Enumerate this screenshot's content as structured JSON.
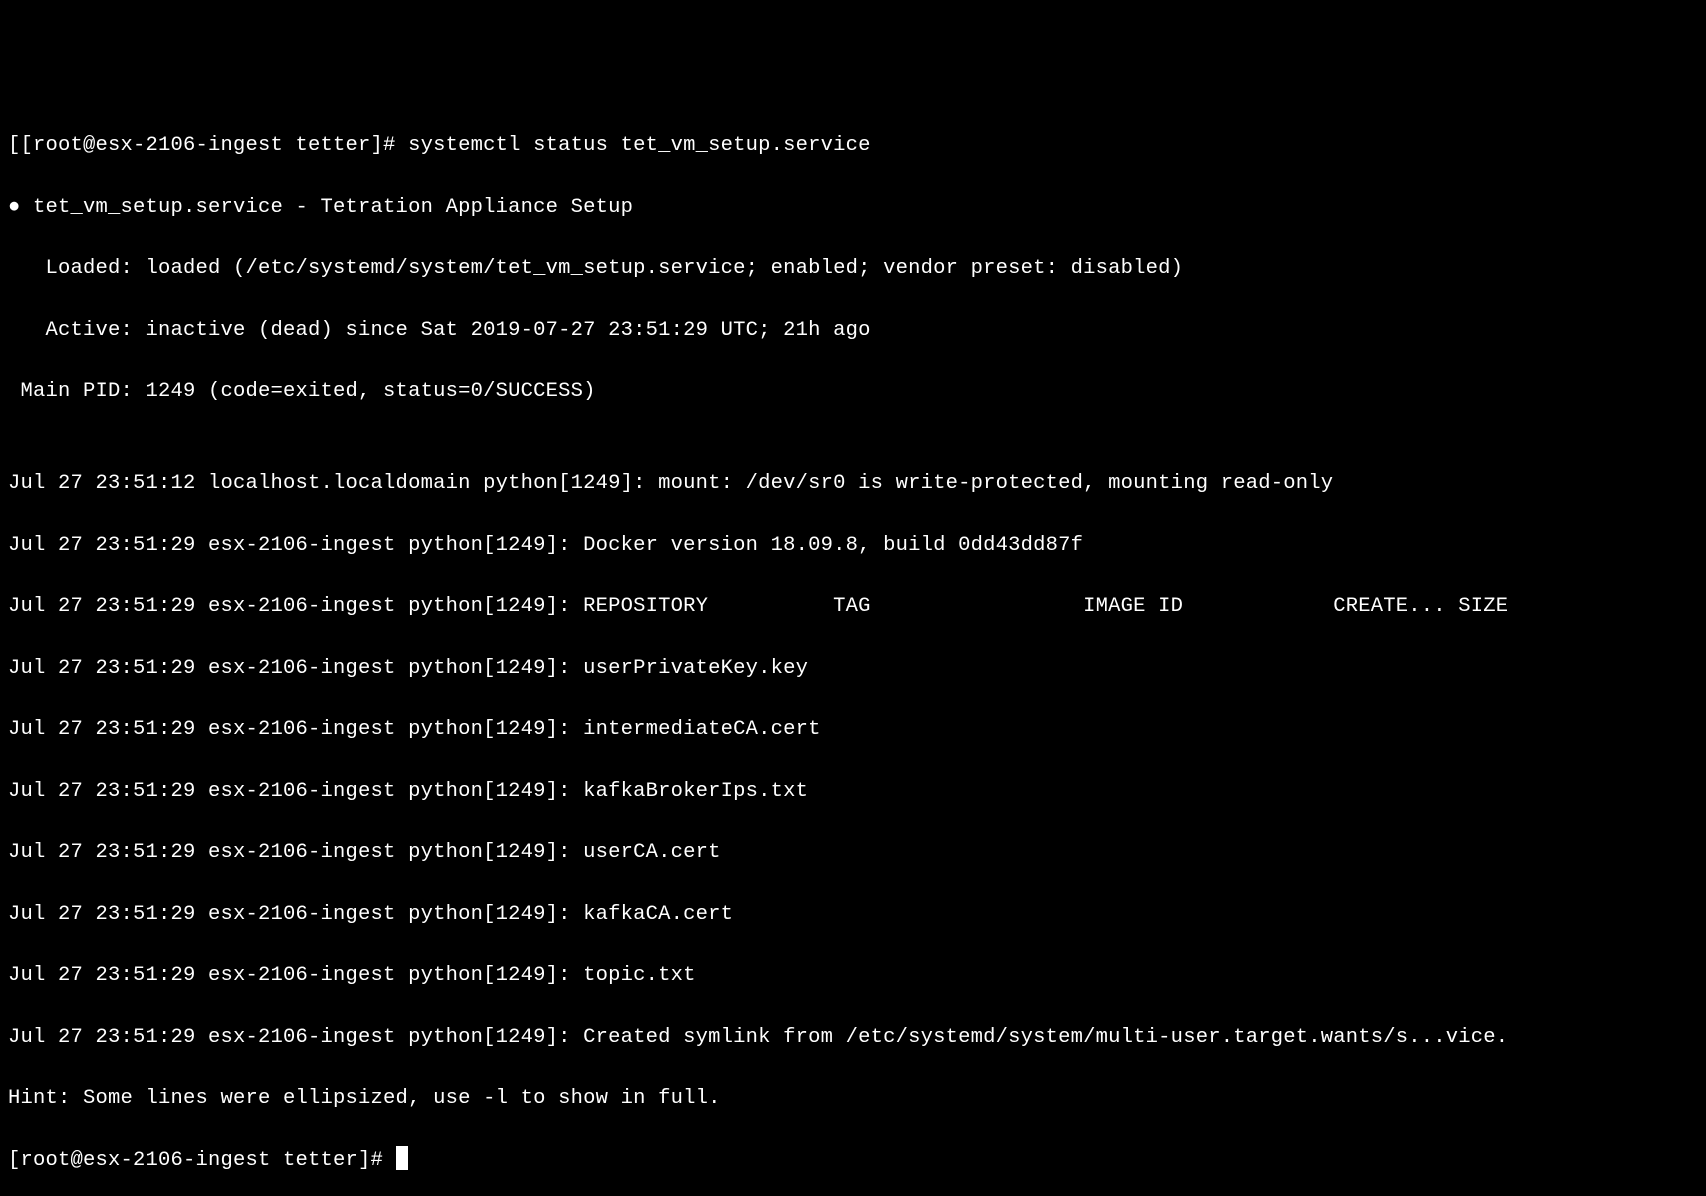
{
  "prompt1_prefix": "[[root@esx-2106-ingest tetter]# ",
  "command": "systemctl status tet_vm_setup.service",
  "unit_line": "● tet_vm_setup.service - Tetration Appliance Setup",
  "loaded_line": "   Loaded: loaded (/etc/systemd/system/tet_vm_setup.service; enabled; vendor preset: disabled)",
  "active_line": "   Active: inactive (dead) since Sat 2019-07-27 23:51:29 UTC; 21h ago",
  "mainpid_line": " Main PID: 1249 (code=exited, status=0/SUCCESS)",
  "blank": "",
  "log1": "Jul 27 23:51:12 localhost.localdomain python[1249]: mount: /dev/sr0 is write-protected, mounting read-only",
  "log2": "Jul 27 23:51:29 esx-2106-ingest python[1249]: Docker version 18.09.8, build 0dd43dd87f",
  "log3": "Jul 27 23:51:29 esx-2106-ingest python[1249]: REPOSITORY          TAG                 IMAGE ID            CREATE... SIZE",
  "log4": "Jul 27 23:51:29 esx-2106-ingest python[1249]: userPrivateKey.key",
  "log5": "Jul 27 23:51:29 esx-2106-ingest python[1249]: intermediateCA.cert",
  "log6": "Jul 27 23:51:29 esx-2106-ingest python[1249]: kafkaBrokerIps.txt",
  "log7": "Jul 27 23:51:29 esx-2106-ingest python[1249]: userCA.cert",
  "log8": "Jul 27 23:51:29 esx-2106-ingest python[1249]: kafkaCA.cert",
  "log9": "Jul 27 23:51:29 esx-2106-ingest python[1249]: topic.txt",
  "log10": "Jul 27 23:51:29 esx-2106-ingest python[1249]: Created symlink from /etc/systemd/system/multi-user.target.wants/s...vice.",
  "hint_line": "Hint: Some lines were ellipsized, use -l to show in full.",
  "prompt2": "[root@esx-2106-ingest tetter]# "
}
